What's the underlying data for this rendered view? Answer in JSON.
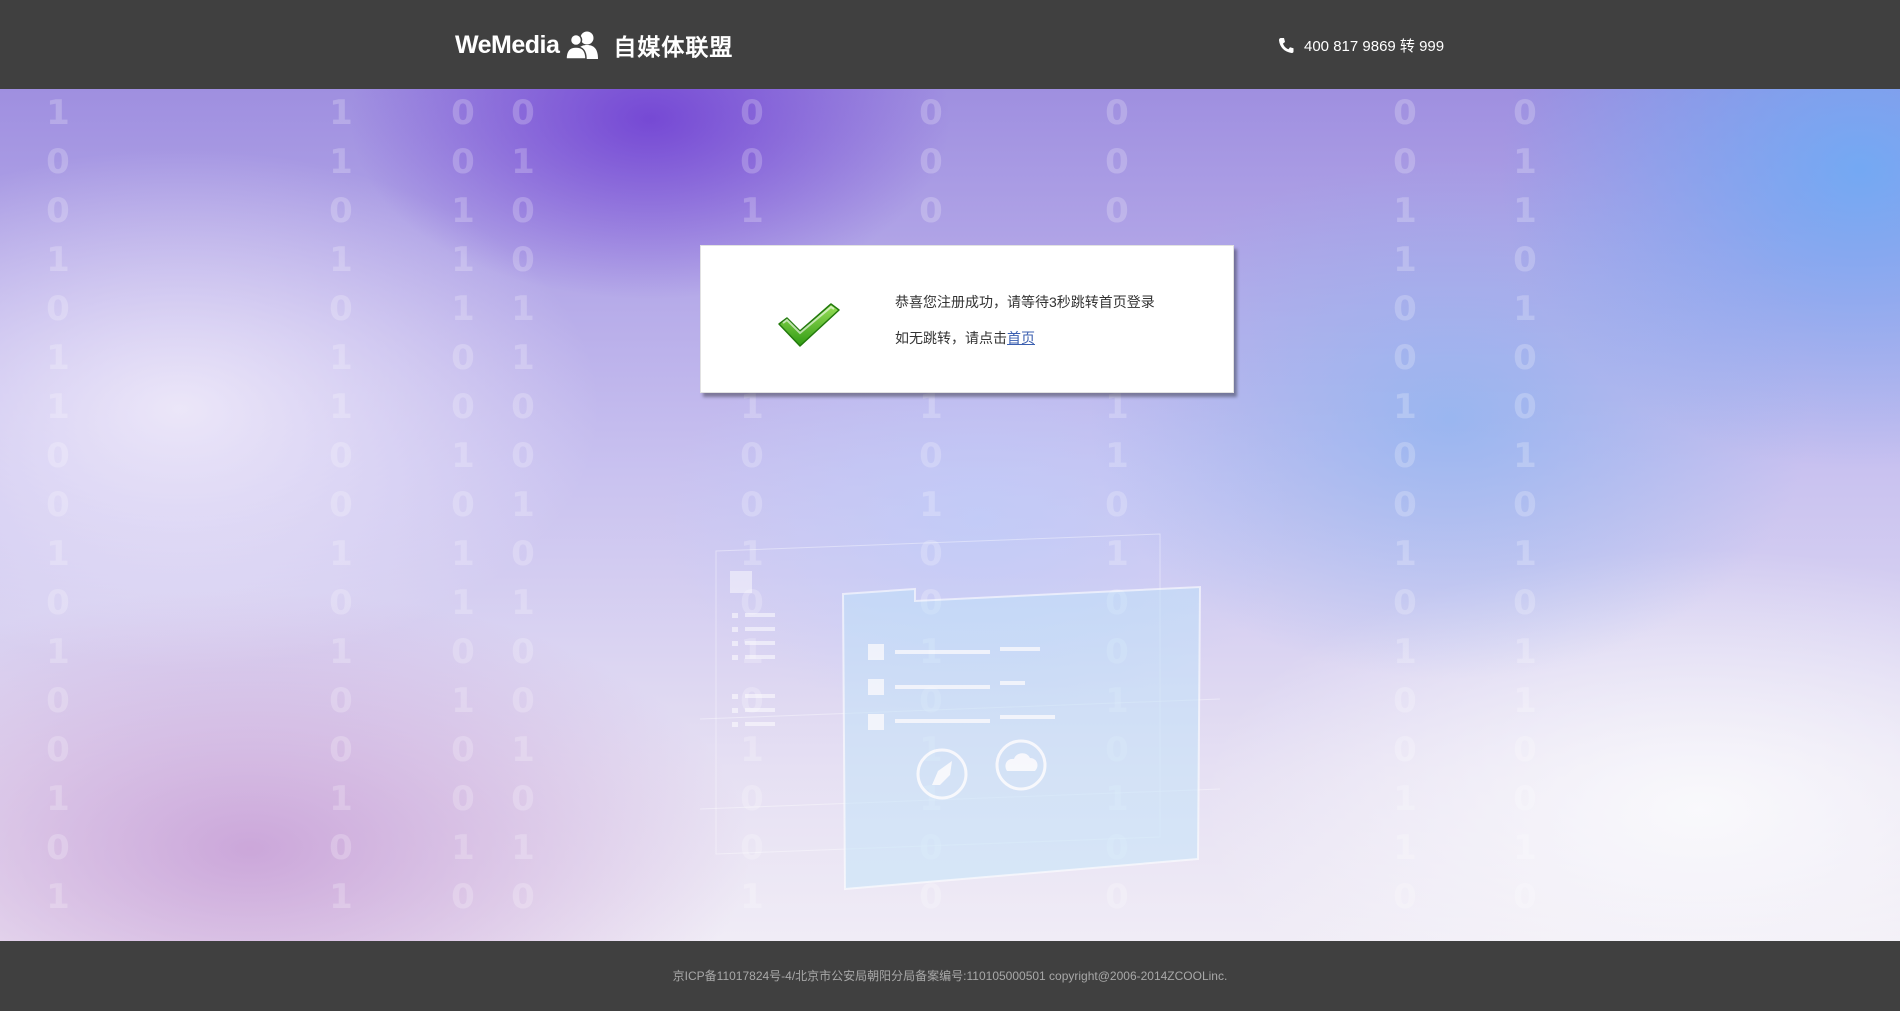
{
  "header": {
    "logo_en": "WeMedia",
    "logo_cn": "自媒体联盟",
    "phone": "400 817 9869 转 999"
  },
  "dialog": {
    "message": "恭喜您注册成功，请等待3秒跳转首页登录",
    "fallback_prefix": "如无跳转，请点击",
    "home_link": "首页"
  },
  "footer": {
    "text": "京ICP备11017824号-4/北京市公安局朝阳分局备案编号:110105000501  copyright@2006-2014ZCOOLinc."
  },
  "icons": {
    "logo": "users-icon",
    "phone": "phone-icon",
    "success": "checkmark-icon"
  },
  "colors": {
    "bar_background": "#404040",
    "link": "#3b5fb0",
    "check_green": "#3aa81a"
  }
}
